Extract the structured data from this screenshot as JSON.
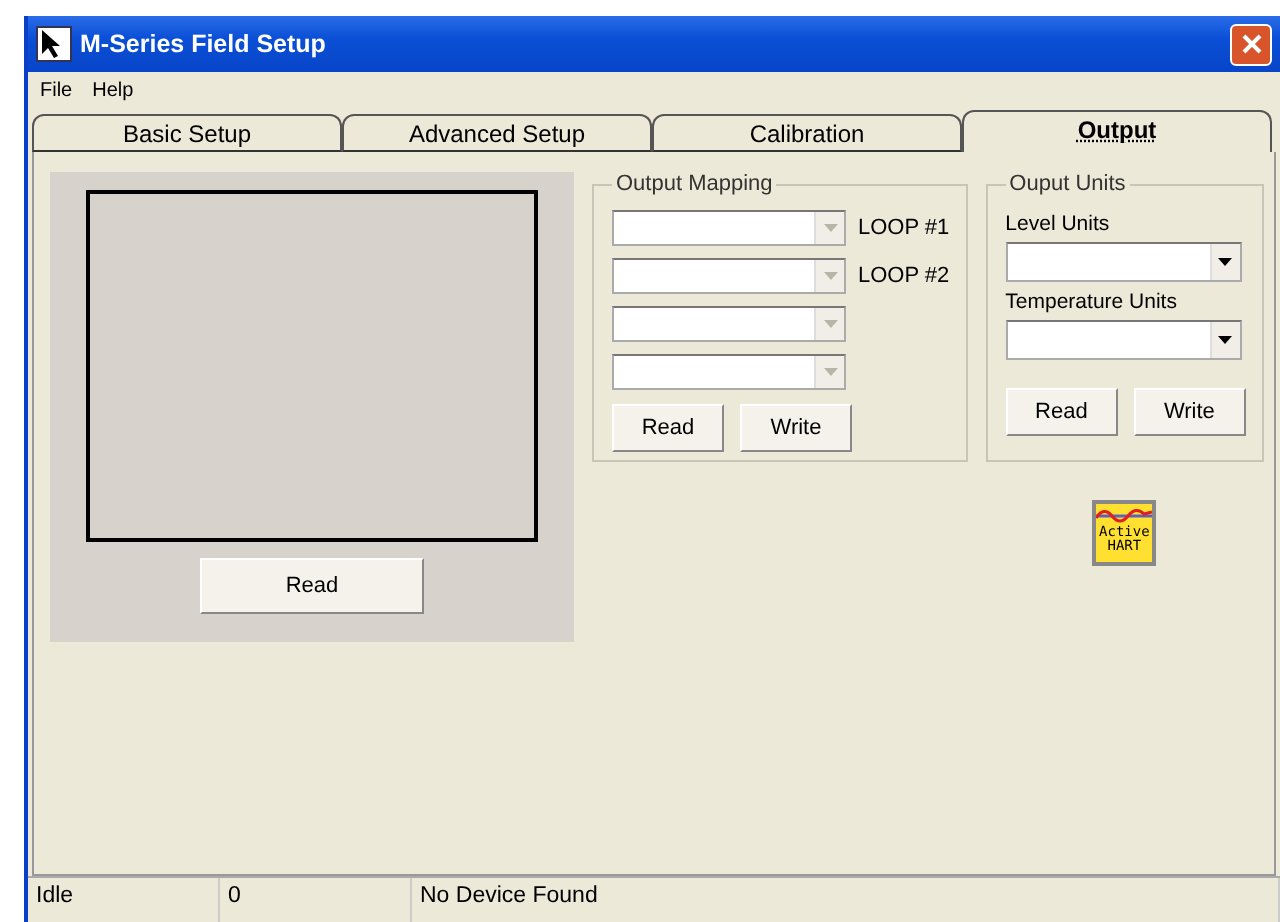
{
  "window": {
    "title": "M-Series Field Setup"
  },
  "menu": [
    "File",
    "Help"
  ],
  "tabs": [
    {
      "label": "Basic Setup",
      "selected": false
    },
    {
      "label": "Advanced Setup",
      "selected": false
    },
    {
      "label": "Calibration",
      "selected": false
    },
    {
      "label": "Output",
      "selected": true
    }
  ],
  "display_panel": {
    "button": "Read"
  },
  "output_mapping": {
    "title": "Output Mapping",
    "rows": [
      {
        "label": "LOOP #1",
        "disabled": true
      },
      {
        "label": "LOOP #2",
        "disabled": true
      },
      {
        "disabled": true
      },
      {
        "disabled": true
      }
    ],
    "buttons": [
      "Read",
      "Write"
    ]
  },
  "output_units": {
    "title": "Ouput Units",
    "fields": [
      {
        "label": "Level Units",
        "disabled": false
      },
      {
        "label": "Temperature Units",
        "disabled": false
      }
    ],
    "buttons": [
      "Read",
      "Write"
    ]
  },
  "hart_button": {
    "lines": [
      "Active",
      "HART"
    ]
  },
  "status_bar": [
    "Idle",
    "0",
    "No Device Found"
  ]
}
